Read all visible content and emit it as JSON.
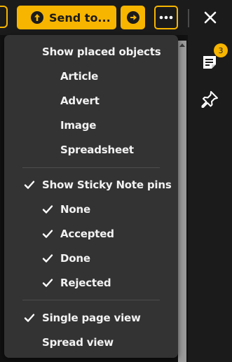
{
  "toolbar": {
    "send_label": "Send to...",
    "send_icon": "arrow-up-circle-icon",
    "go_icon": "arrow-right-circle-icon",
    "more_icon": "more-dots-icon",
    "close_icon": "close-icon"
  },
  "side_panel": {
    "notes_icon": "sticky-notes-icon",
    "notes_badge": "3",
    "pin_icon": "pin-icon"
  },
  "colors": {
    "accent": "#f7b500",
    "menu_background": "#333333",
    "menu_text": "#f2f2f2",
    "app_background": "#1b1b1b"
  },
  "menu": {
    "show_placed_objects": {
      "label": "Show placed objects",
      "checked": false
    },
    "placed_objects": [
      {
        "label": "Article",
        "checked": false
      },
      {
        "label": "Advert",
        "checked": false
      },
      {
        "label": "Image",
        "checked": false
      },
      {
        "label": "Spreadsheet",
        "checked": false
      }
    ],
    "show_sticky_pins": {
      "label": "Show Sticky Note pins",
      "checked": true
    },
    "sticky_pins": [
      {
        "label": "None",
        "checked": true
      },
      {
        "label": "Accepted",
        "checked": true
      },
      {
        "label": "Done",
        "checked": true
      },
      {
        "label": "Rejected",
        "checked": true
      }
    ],
    "view_modes": [
      {
        "label": "Single page view",
        "checked": true
      },
      {
        "label": "Spread view",
        "checked": false
      }
    ]
  }
}
